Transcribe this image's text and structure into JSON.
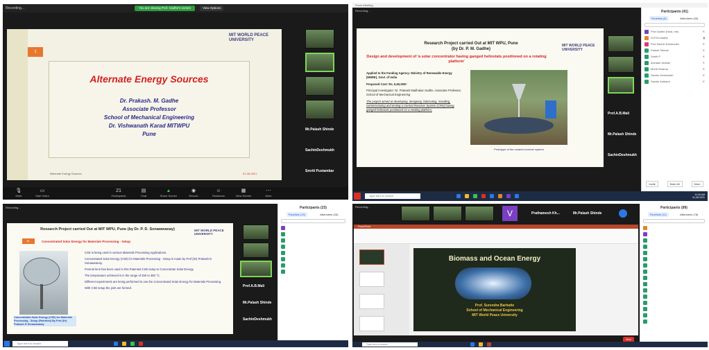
{
  "q1": {
    "window_title": "Recording...",
    "share_banner": "You are viewing Prof. Gadhe's screen",
    "view_options": "View Options",
    "slide_number": "1",
    "logo_line1": "MIT WORLD PEACE",
    "logo_line2": "UNIVERSITY",
    "title": "Alternate Energy Sources",
    "author": "Dr. Prakash. M. Gadhe",
    "role": "Associate Professor",
    "school": "School of Mechanical Engineering",
    "institute": "Dr. Vishwanath Karad MITWPU",
    "city": "Pune",
    "footer_left": "Alternate Energy Sources",
    "footer_right": "01-08-2021",
    "participants": [
      "Prof.Gadhe",
      "Mr.Palash Shinde",
      "SachinDeshmukh",
      "Smriti Pustambar"
    ],
    "toolbar": [
      "Mute",
      "Start Video",
      "Participants",
      "Chat",
      "Share Screen",
      "Record",
      "Reactions",
      "View Screen",
      "More"
    ],
    "participant_count": "21"
  },
  "q2": {
    "window_title": "Zoom Meeting",
    "recording": "Recording...",
    "header1": "Research Project carried Out at MIT WPU, Pune",
    "header2": "(by Dr. P. M. Gadhe)",
    "subtitle": "Design and development of 'a solar concentrator having ganged heliostats positioned on a rotating platform'",
    "logo_line1": "MIT WORLD PEACE",
    "logo_line2": "UNIVERSITY",
    "bullets": [
      "Applied to the Funding Agency: Ministry of Renewable Energy (MNRE), Govt. of India",
      "Proposed Cost: Rs. 6,50,000/-",
      "Principal Investigator: Dr. Prakash Madhukar Gadhe, Associate Professor, School of Mechanical Engineering",
      "The project aimed at developing, designing, fabricating, installing, commissioning and testing a Central Receiver System (CRS) having ganged heliostats positioned on a rotating platform."
    ],
    "caption": "Prototype of the created receiver system",
    "participants_title": "Participants (41)",
    "panel_tabs": [
      "Panelists (8)",
      "Attendees (33)"
    ],
    "panel_names": [
      "Prof.Gadhe (Host, me)",
      "Dr.P.M.Gadhe",
      "Prof.Sachin Deshmukh",
      "Palash Shinde",
      "Smriti P",
      "Avinash Jadhav",
      "Mohit Sharma",
      "Sachin Deshmukh",
      "Sachin Kulkarni"
    ],
    "participants_right": [
      "Prof.A.B.Mali",
      "Mr.Palash Shinde",
      "SachinDeshmukh"
    ],
    "invite": "Invite",
    "mute_all": "Mute All",
    "more": "More",
    "taskbar_search": "Type here to search",
    "clock_time": "11:40 AM",
    "clock_date": "01-08-2021"
  },
  "q3": {
    "recording": "Recording...",
    "header": "Research Project carried Out at MIT WPU, Pune (by Dr. P. D. Sonawwanay)",
    "subtitle": "Concentrated Solar Energy for Materials Processing - Setup",
    "logo_line1": "MIT WORLD PEACE",
    "logo_line2": "UNIVERSITY",
    "tag": "Sr.",
    "image_caption": "Concentrated Solar Energy (CSE) for Materials Processing - Setup (Patented) By Prof (Dr) Prakash D Sonawwanay",
    "bullets": [
      "CSE is being used in various Materials Processing Applications.",
      "Concentrated Solar Energy (CSE) for Materials Processing - Setup is made by Prof (Dr) Prakash D Sonawwanay.",
      "Fresnel lens has been used in this Patented CSE setup to Concentrate Solar Energy.",
      "The temperature achieved is in the range of 250 to 350 °C.",
      "Different experiments are being performed to use the Concentrated Solar Energy for Materials Processing.",
      "With CSE setup the joint are formed."
    ],
    "participants": [
      "Prof.A.B.Mali",
      "Mr.Palash Shinde",
      "SachinDeshmukh"
    ],
    "panel_title": "Participants (23)",
    "panel_tabs": [
      "Panelists (15)",
      "Attendees (33)"
    ],
    "taskbar_search": "Type here to search"
  },
  "q4": {
    "recording": "Recording...",
    "speakers": [
      "Prathamesh Kh...",
      "Mr.Palash Shinde"
    ],
    "avatar_letter": "V",
    "app_title": "PowerPoint",
    "slide_title": "Biomass and Ocean Energy",
    "speaker": "Prof. Surendra Barhatte",
    "school": "School of Mechanical Engineering",
    "university": "MIT World Peace University",
    "panel_title": "Participants (89)",
    "panel_tabs": [
      "Panelists (11)",
      "Attendees (78)"
    ],
    "end_label": "End",
    "taskbar_search": "Type here to search"
  }
}
